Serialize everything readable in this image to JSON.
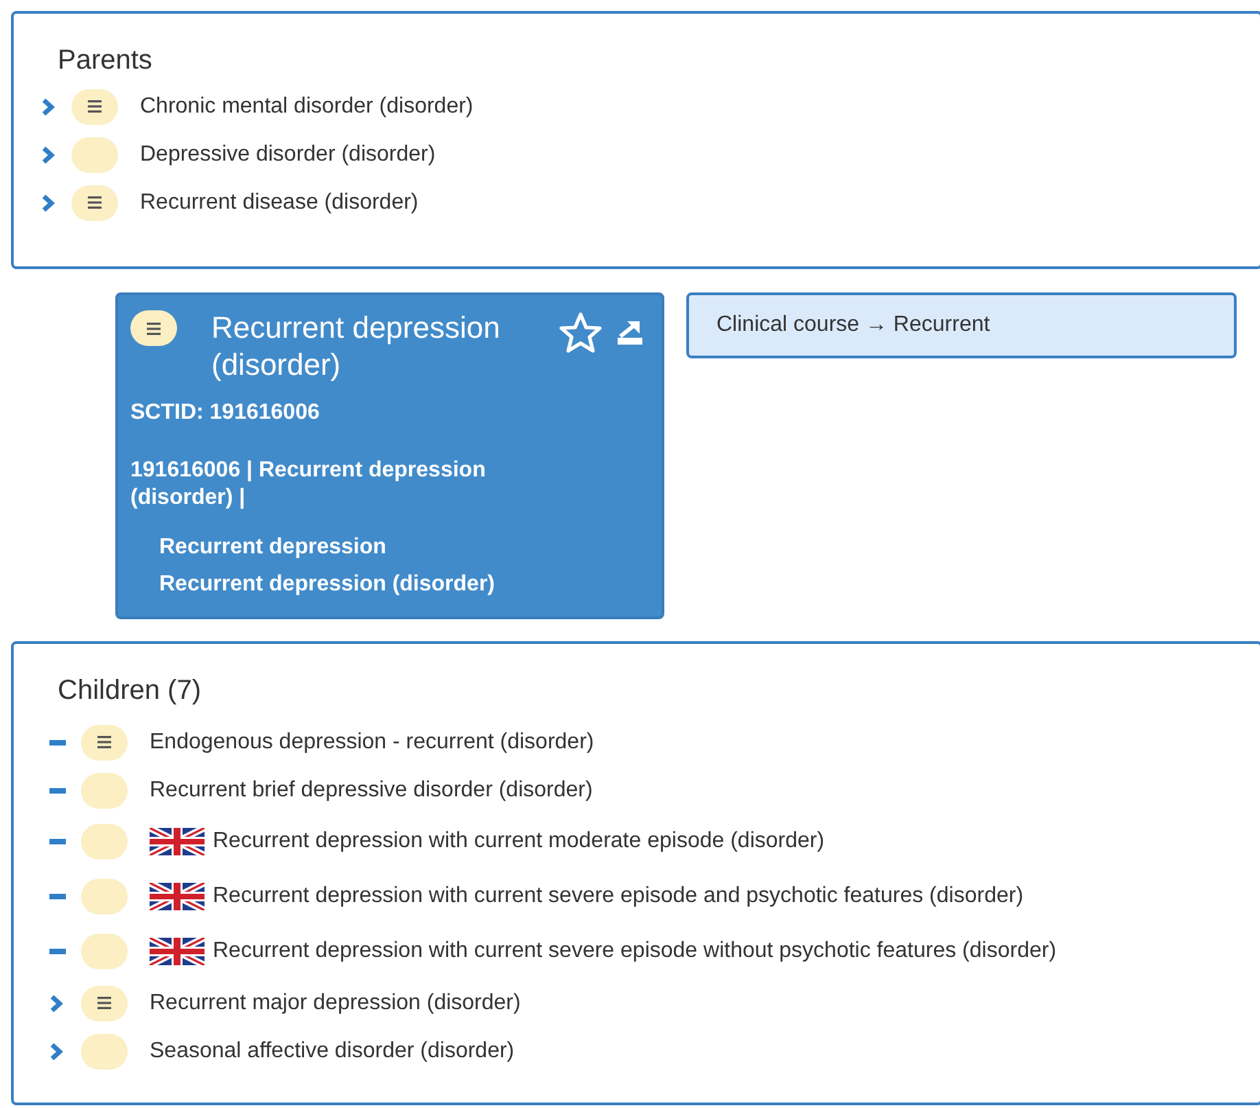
{
  "parents": {
    "title": "Parents",
    "items": [
      {
        "label": "Chronic mental disorder (disorder)",
        "defined": true,
        "kind": "chevron"
      },
      {
        "label": "Depressive disorder (disorder)",
        "defined": false,
        "kind": "chevron"
      },
      {
        "label": "Recurrent disease (disorder)",
        "defined": true,
        "kind": "chevron"
      }
    ]
  },
  "concept": {
    "defined": true,
    "title": "Recurrent depression (disorder)",
    "sctid": "SCTID: 191616006",
    "expression": "191616006 | Recurrent depression (disorder) |",
    "descriptions": [
      "Recurrent depression",
      "Recurrent depression (disorder)"
    ]
  },
  "relationship": {
    "attribute": "Clinical course",
    "arrow": "→",
    "value": "Recurrent"
  },
  "children": {
    "title": "Children (7)",
    "items": [
      {
        "label": "Endogenous depression - recurrent (disorder)",
        "defined": true,
        "kind": "dash",
        "uk_flag": false
      },
      {
        "label": "Recurrent brief depressive disorder (disorder)",
        "defined": false,
        "kind": "dash",
        "uk_flag": false
      },
      {
        "label": "Recurrent depression with current moderate episode (disorder)",
        "defined": false,
        "kind": "dash",
        "uk_flag": true
      },
      {
        "label": "Recurrent depression with current severe episode and psychotic features (disorder)",
        "defined": false,
        "kind": "dash",
        "uk_flag": true
      },
      {
        "label": "Recurrent depression with current severe episode without psychotic features (disorder)",
        "defined": false,
        "kind": "dash",
        "uk_flag": true
      },
      {
        "label": "Recurrent major depression (disorder)",
        "defined": true,
        "kind": "chevron",
        "uk_flag": false
      },
      {
        "label": "Seasonal affective disorder (disorder)",
        "defined": false,
        "kind": "chevron",
        "uk_flag": false
      }
    ]
  }
}
